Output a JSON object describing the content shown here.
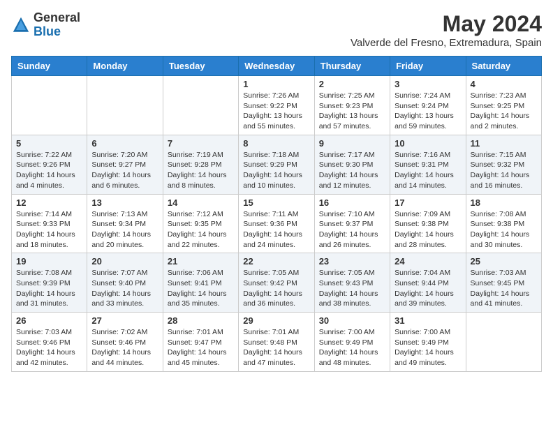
{
  "logo": {
    "general": "General",
    "blue": "Blue"
  },
  "title": {
    "month_year": "May 2024",
    "location": "Valverde del Fresno, Extremadura, Spain"
  },
  "days_of_week": [
    "Sunday",
    "Monday",
    "Tuesday",
    "Wednesday",
    "Thursday",
    "Friday",
    "Saturday"
  ],
  "weeks": [
    [
      {
        "day": "",
        "info": ""
      },
      {
        "day": "",
        "info": ""
      },
      {
        "day": "",
        "info": ""
      },
      {
        "day": "1",
        "info": "Sunrise: 7:26 AM\nSunset: 9:22 PM\nDaylight: 13 hours\nand 55 minutes."
      },
      {
        "day": "2",
        "info": "Sunrise: 7:25 AM\nSunset: 9:23 PM\nDaylight: 13 hours\nand 57 minutes."
      },
      {
        "day": "3",
        "info": "Sunrise: 7:24 AM\nSunset: 9:24 PM\nDaylight: 13 hours\nand 59 minutes."
      },
      {
        "day": "4",
        "info": "Sunrise: 7:23 AM\nSunset: 9:25 PM\nDaylight: 14 hours\nand 2 minutes."
      }
    ],
    [
      {
        "day": "5",
        "info": "Sunrise: 7:22 AM\nSunset: 9:26 PM\nDaylight: 14 hours\nand 4 minutes."
      },
      {
        "day": "6",
        "info": "Sunrise: 7:20 AM\nSunset: 9:27 PM\nDaylight: 14 hours\nand 6 minutes."
      },
      {
        "day": "7",
        "info": "Sunrise: 7:19 AM\nSunset: 9:28 PM\nDaylight: 14 hours\nand 8 minutes."
      },
      {
        "day": "8",
        "info": "Sunrise: 7:18 AM\nSunset: 9:29 PM\nDaylight: 14 hours\nand 10 minutes."
      },
      {
        "day": "9",
        "info": "Sunrise: 7:17 AM\nSunset: 9:30 PM\nDaylight: 14 hours\nand 12 minutes."
      },
      {
        "day": "10",
        "info": "Sunrise: 7:16 AM\nSunset: 9:31 PM\nDaylight: 14 hours\nand 14 minutes."
      },
      {
        "day": "11",
        "info": "Sunrise: 7:15 AM\nSunset: 9:32 PM\nDaylight: 14 hours\nand 16 minutes."
      }
    ],
    [
      {
        "day": "12",
        "info": "Sunrise: 7:14 AM\nSunset: 9:33 PM\nDaylight: 14 hours\nand 18 minutes."
      },
      {
        "day": "13",
        "info": "Sunrise: 7:13 AM\nSunset: 9:34 PM\nDaylight: 14 hours\nand 20 minutes."
      },
      {
        "day": "14",
        "info": "Sunrise: 7:12 AM\nSunset: 9:35 PM\nDaylight: 14 hours\nand 22 minutes."
      },
      {
        "day": "15",
        "info": "Sunrise: 7:11 AM\nSunset: 9:36 PM\nDaylight: 14 hours\nand 24 minutes."
      },
      {
        "day": "16",
        "info": "Sunrise: 7:10 AM\nSunset: 9:37 PM\nDaylight: 14 hours\nand 26 minutes."
      },
      {
        "day": "17",
        "info": "Sunrise: 7:09 AM\nSunset: 9:38 PM\nDaylight: 14 hours\nand 28 minutes."
      },
      {
        "day": "18",
        "info": "Sunrise: 7:08 AM\nSunset: 9:38 PM\nDaylight: 14 hours\nand 30 minutes."
      }
    ],
    [
      {
        "day": "19",
        "info": "Sunrise: 7:08 AM\nSunset: 9:39 PM\nDaylight: 14 hours\nand 31 minutes."
      },
      {
        "day": "20",
        "info": "Sunrise: 7:07 AM\nSunset: 9:40 PM\nDaylight: 14 hours\nand 33 minutes."
      },
      {
        "day": "21",
        "info": "Sunrise: 7:06 AM\nSunset: 9:41 PM\nDaylight: 14 hours\nand 35 minutes."
      },
      {
        "day": "22",
        "info": "Sunrise: 7:05 AM\nSunset: 9:42 PM\nDaylight: 14 hours\nand 36 minutes."
      },
      {
        "day": "23",
        "info": "Sunrise: 7:05 AM\nSunset: 9:43 PM\nDaylight: 14 hours\nand 38 minutes."
      },
      {
        "day": "24",
        "info": "Sunrise: 7:04 AM\nSunset: 9:44 PM\nDaylight: 14 hours\nand 39 minutes."
      },
      {
        "day": "25",
        "info": "Sunrise: 7:03 AM\nSunset: 9:45 PM\nDaylight: 14 hours\nand 41 minutes."
      }
    ],
    [
      {
        "day": "26",
        "info": "Sunrise: 7:03 AM\nSunset: 9:46 PM\nDaylight: 14 hours\nand 42 minutes."
      },
      {
        "day": "27",
        "info": "Sunrise: 7:02 AM\nSunset: 9:46 PM\nDaylight: 14 hours\nand 44 minutes."
      },
      {
        "day": "28",
        "info": "Sunrise: 7:01 AM\nSunset: 9:47 PM\nDaylight: 14 hours\nand 45 minutes."
      },
      {
        "day": "29",
        "info": "Sunrise: 7:01 AM\nSunset: 9:48 PM\nDaylight: 14 hours\nand 47 minutes."
      },
      {
        "day": "30",
        "info": "Sunrise: 7:00 AM\nSunset: 9:49 PM\nDaylight: 14 hours\nand 48 minutes."
      },
      {
        "day": "31",
        "info": "Sunrise: 7:00 AM\nSunset: 9:49 PM\nDaylight: 14 hours\nand 49 minutes."
      },
      {
        "day": "",
        "info": ""
      }
    ]
  ]
}
